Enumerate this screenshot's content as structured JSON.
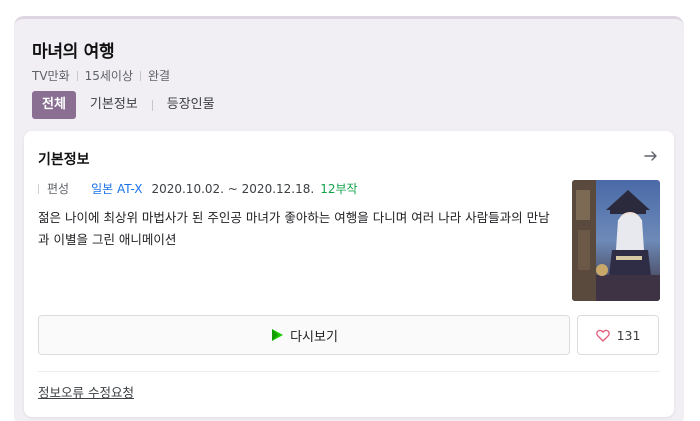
{
  "anime": {
    "title": "마녀의 여행",
    "meta": [
      "TV만화",
      "15세이상",
      "완결"
    ]
  },
  "tabs": [
    {
      "label": "전체",
      "active": true
    },
    {
      "label": "기본정보",
      "active": false
    },
    {
      "label": "등장인물",
      "active": false
    }
  ],
  "basic_info": {
    "section_title": "기본정보",
    "broadcast_label": "편성",
    "channel": "일본 AT-X",
    "dates": "2020.10.02. ~ 2020.12.18.",
    "episodes": "12부작",
    "description": "젊은 나이에 최상위 마법사가 된 주인공 마녀가 좋아하는 여행을 다니며 여러 나라 사람들과의 만남과 이별을 그린 애니메이션"
  },
  "actions": {
    "watch_label": "다시보기",
    "like_count": "131"
  },
  "footer": {
    "report_label": "정보오류 수정요청"
  },
  "colors": {
    "accent_tab": "#8a6f93",
    "channel_link": "#1a73e8",
    "episode_green": "#14a34a",
    "heart": "#e05a7a",
    "play_green": "#1ec800"
  },
  "icons": {
    "arrow": "arrow-right-icon",
    "play": "play-icon",
    "heart": "heart-icon"
  }
}
